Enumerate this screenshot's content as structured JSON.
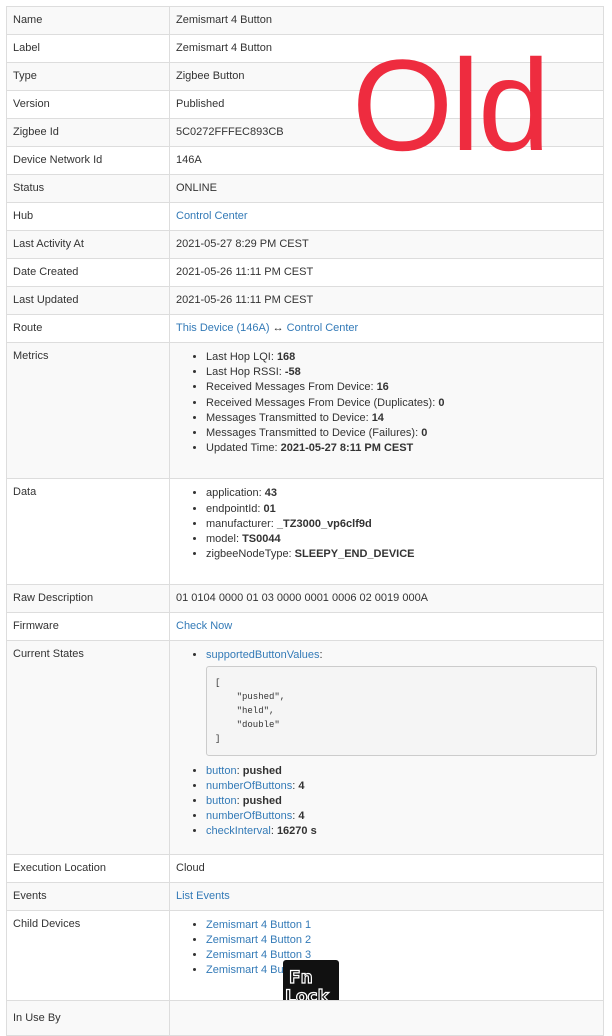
{
  "watermark": "Old",
  "logo": {
    "name": "logo",
    "text": "FnLock"
  },
  "colors": {
    "link": "#337ab7",
    "watermark": "#ee2c3f",
    "border": "#dddddd"
  },
  "rows": {
    "name": {
      "key": "Name",
      "value": "Zemismart 4 Button"
    },
    "label": {
      "key": "Label",
      "value": "Zemismart 4 Button"
    },
    "type": {
      "key": "Type",
      "value": "Zigbee Button"
    },
    "version": {
      "key": "Version",
      "value": "Published"
    },
    "zigbee_id": {
      "key": "Zigbee Id",
      "value": "5C0272FFFEC893CB"
    },
    "network_id": {
      "key": "Device Network Id",
      "value": "146A"
    },
    "status": {
      "key": "Status",
      "value": "ONLINE"
    },
    "hub": {
      "key": "Hub",
      "value": "Control Center"
    },
    "last_activity": {
      "key": "Last Activity At",
      "value": "2021-05-27 8:29 PM CEST"
    },
    "date_created": {
      "key": "Date Created",
      "value": "2021-05-26 11:11 PM CEST"
    },
    "last_updated": {
      "key": "Last Updated",
      "value": "2021-05-26 11:11 PM CEST"
    },
    "route": {
      "key": "Route",
      "from": "This Device (146A)",
      "arrow": "↔",
      "to": "Control Center"
    },
    "metrics": {
      "key": "Metrics",
      "items": [
        {
          "label": "Last Hop LQI: ",
          "value": "168"
        },
        {
          "label": "Last Hop RSSI: ",
          "value": "-58"
        },
        {
          "label": "Received Messages From Device: ",
          "value": "16"
        },
        {
          "label": "Received Messages From Device (Duplicates): ",
          "value": "0"
        },
        {
          "label": "Messages Transmitted to Device: ",
          "value": "14"
        },
        {
          "label": "Messages Transmitted to Device (Failures): ",
          "value": "0"
        },
        {
          "label": "Updated Time: ",
          "value": "2021-05-27 8:11 PM CEST"
        }
      ]
    },
    "data": {
      "key": "Data",
      "items": [
        {
          "label": "application: ",
          "value": "43"
        },
        {
          "label": "endpointId: ",
          "value": "01"
        },
        {
          "label": "manufacturer: ",
          "value": "_TZ3000_vp6clf9d"
        },
        {
          "label": "model: ",
          "value": "TS0044"
        },
        {
          "label": "zigbeeNodeType: ",
          "value": "SLEEPY_END_DEVICE"
        }
      ]
    },
    "raw_description": {
      "key": "Raw Description",
      "value": "01 0104 0000 01 03 0000 0001 0006 02 0019 000A"
    },
    "firmware": {
      "key": "Firmware",
      "value": "Check Now"
    },
    "current_states": {
      "key": "Current States",
      "supported": {
        "name": "supportedButtonValues",
        "sep": ":",
        "json": "[\n    \"pushed\",\n    \"held\",\n    \"double\"\n]"
      },
      "items": [
        {
          "attr": "button",
          "sep": ": ",
          "value": "pushed"
        },
        {
          "attr": "numberOfButtons",
          "sep": ": ",
          "value": "4"
        },
        {
          "attr": "button",
          "sep": ": ",
          "value": "pushed"
        },
        {
          "attr": "numberOfButtons",
          "sep": ": ",
          "value": "4"
        },
        {
          "attr": "checkInterval",
          "sep": ": ",
          "value": "16270 s"
        }
      ]
    },
    "execution_location": {
      "key": "Execution Location",
      "value": "Cloud"
    },
    "events": {
      "key": "Events",
      "value": "List Events"
    },
    "child_devices": {
      "key": "Child Devices",
      "items": [
        "Zemismart 4 Button 1",
        "Zemismart 4 Button 2",
        "Zemismart 4 Button 3",
        "Zemismart 4 Button 4"
      ]
    },
    "in_use_by": {
      "key": "In Use By",
      "value": ""
    }
  }
}
